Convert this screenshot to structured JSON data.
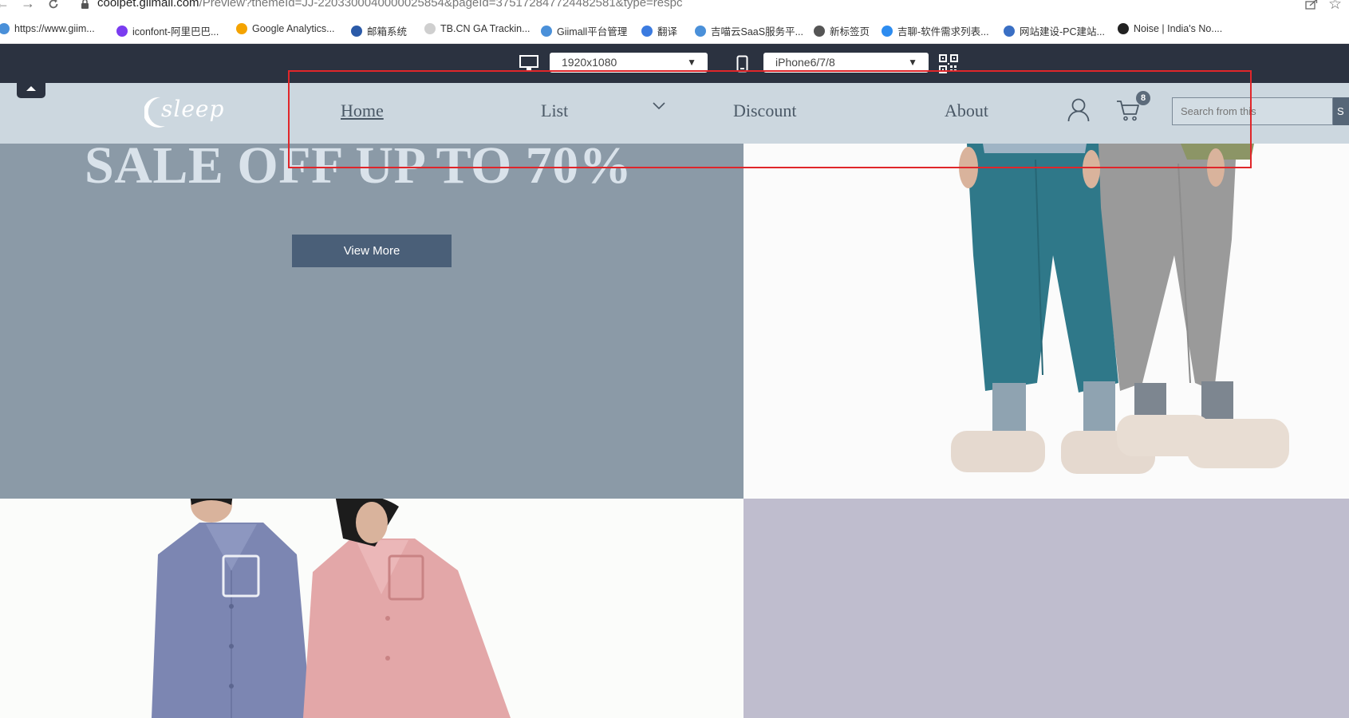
{
  "browser": {
    "url_host": "coolpet.giimall.com",
    "url_path": "/Preview?themeId=JJ-2203300040000025854&pageId=375172847724482581&type=respc",
    "bookmarks": [
      {
        "label": "https://www.giim...",
        "color": "#4a90d9"
      },
      {
        "label": "iconfont-阿里巴巴...",
        "color": "#7a3cf0"
      },
      {
        "label": "Google Analytics...",
        "color": "#f4a300"
      },
      {
        "label": "邮箱系统",
        "color": "#2b5aa8"
      },
      {
        "label": "TB.CN GA Trackin...",
        "color": "#cfcfcf"
      },
      {
        "label": "Giimall平台管理",
        "color": "#4a90d9"
      },
      {
        "label": "翻译",
        "color": "#3b7be0"
      },
      {
        "label": "吉喵云SaaS服务平...",
        "color": "#4a90d9"
      },
      {
        "label": "新标签页",
        "color": "#555555"
      },
      {
        "label": "吉聊-软件需求列表...",
        "color": "#2d8cf0"
      },
      {
        "label": "网站建设-PC建站...",
        "color": "#3a6fc4"
      },
      {
        "label": "Noise | India's No....",
        "color": "#222222"
      }
    ]
  },
  "preview_toolbar": {
    "desktop_resolution": "1920x1080",
    "mobile_device": "iPhone6/7/8"
  },
  "site": {
    "logo_text": "sleep",
    "nav": [
      {
        "label": "Home",
        "active": true
      },
      {
        "label": "List",
        "active": false
      },
      {
        "label": "Discount",
        "active": false
      },
      {
        "label": "About",
        "active": false
      }
    ],
    "cart_count": "8",
    "search_placeholder": "Search from this",
    "search_button": "S"
  },
  "hero": {
    "sale_title": "SALE OFF UP TO 70%",
    "cta": "View More"
  },
  "colors": {
    "header_bg": "#ccd7df",
    "toolbar_bg": "#2b3240",
    "promo_bg": "#8b9aa7",
    "cta_bg": "#4a5f78",
    "lilac_bg": "#bfbdce",
    "annotation_red": "#e0262a"
  }
}
